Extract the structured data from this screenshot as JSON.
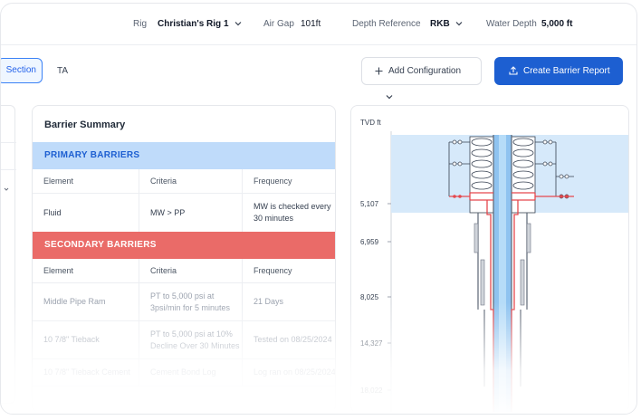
{
  "header": {
    "rig_label": "Rig",
    "rig_value": "Christian's Rig 1",
    "air_gap_label": "Air Gap",
    "air_gap_value": "101ft",
    "depth_ref_label": "Depth Reference",
    "depth_ref_value": "RKB",
    "water_depth_label": "Water Depth",
    "water_depth_value": "5,000 ft"
  },
  "toolbar": {
    "tabs": [
      {
        "label": "Section"
      },
      {
        "label": "TA"
      }
    ],
    "add_config_label": "Add Configuration",
    "create_report_label": "Create Barrier Report"
  },
  "barrier_summary": {
    "title": "Barrier Summary",
    "columns": [
      "Element",
      "Criteria",
      "Frequency"
    ],
    "primary": {
      "title": "PRIMARY BARRIERS",
      "rows": [
        {
          "element": "Fluid",
          "criteria": "MW > PP",
          "frequency": "MW is checked every 30 minutes"
        }
      ]
    },
    "secondary": {
      "title": "SECONDARY BARRIERS",
      "rows": [
        {
          "element": "Middle Pipe Ram",
          "criteria": "PT to 5,000 psi at 3psi/min for 5 minutes",
          "frequency": "21 Days"
        },
        {
          "element": "10 7/8\" Tieback",
          "criteria": "PT to 5,000 psi at 10% Decline Over 30 Minutes",
          "frequency": "Tested on 08/25/2024"
        },
        {
          "element": "10 7/8\" Tieback Cement",
          "criteria": "Cement Bond Log",
          "frequency": "Log ran on 08/25/2024"
        }
      ]
    }
  },
  "wellbore": {
    "axis_title": "TVD ft",
    "ticks": [
      "5,107",
      "6,959",
      "8,025",
      "14,327",
      "18,022"
    ],
    "colors": {
      "zone": "#d6e9fa",
      "fluid": "#8fc3f0",
      "barrier": "#e5484d",
      "steel": "#5b6473"
    }
  }
}
